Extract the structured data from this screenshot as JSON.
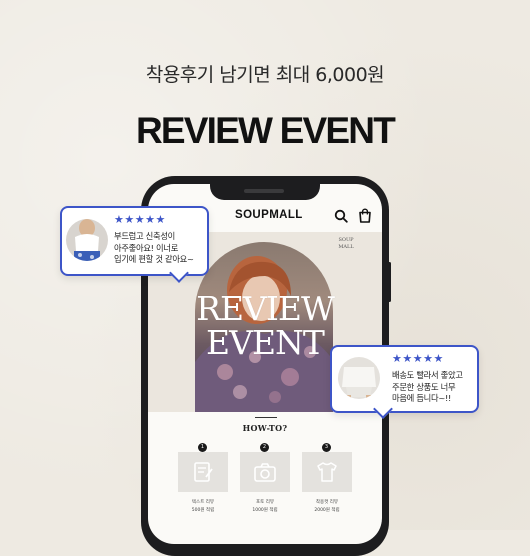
{
  "header": {
    "subtitle": "착용후기 남기면 최대 6,000원",
    "headline": "REVIEW EVENT"
  },
  "app": {
    "brand": "SOUPMALL",
    "brand_small": "SOUP MALL",
    "icons": [
      "search-icon",
      "shopping-bag-icon"
    ]
  },
  "banner": {
    "script_text": "REVIEW EVENT"
  },
  "howto": {
    "title": "HOW-TO?",
    "steps": [
      {
        "num": "1",
        "icon": "pencil-note-icon",
        "label1": "텍스트 리뷰",
        "label2": "500원 적립"
      },
      {
        "num": "2",
        "icon": "camera-icon",
        "label1": "포토 리뷰",
        "label2": "1000원 적립"
      },
      {
        "num": "3",
        "icon": "tshirt-icon",
        "label1": "착용컷 리뷰",
        "label2": "2000원 적립"
      }
    ]
  },
  "reviews": [
    {
      "stars": "★★★★★",
      "lines": [
        "부드럽고 신축성이",
        "아주좋아요! 이너로",
        "입기에 편할 것 같아요~"
      ]
    },
    {
      "stars": "★★★★★",
      "lines": [
        "배송도 빨라서 좋았고",
        "주문한 상품도 너무",
        "마음에 듭니다~!!"
      ]
    }
  ],
  "colors": {
    "background": "#eeeae2",
    "accent": "#3d55c8",
    "phone": "#1d1d1f"
  }
}
